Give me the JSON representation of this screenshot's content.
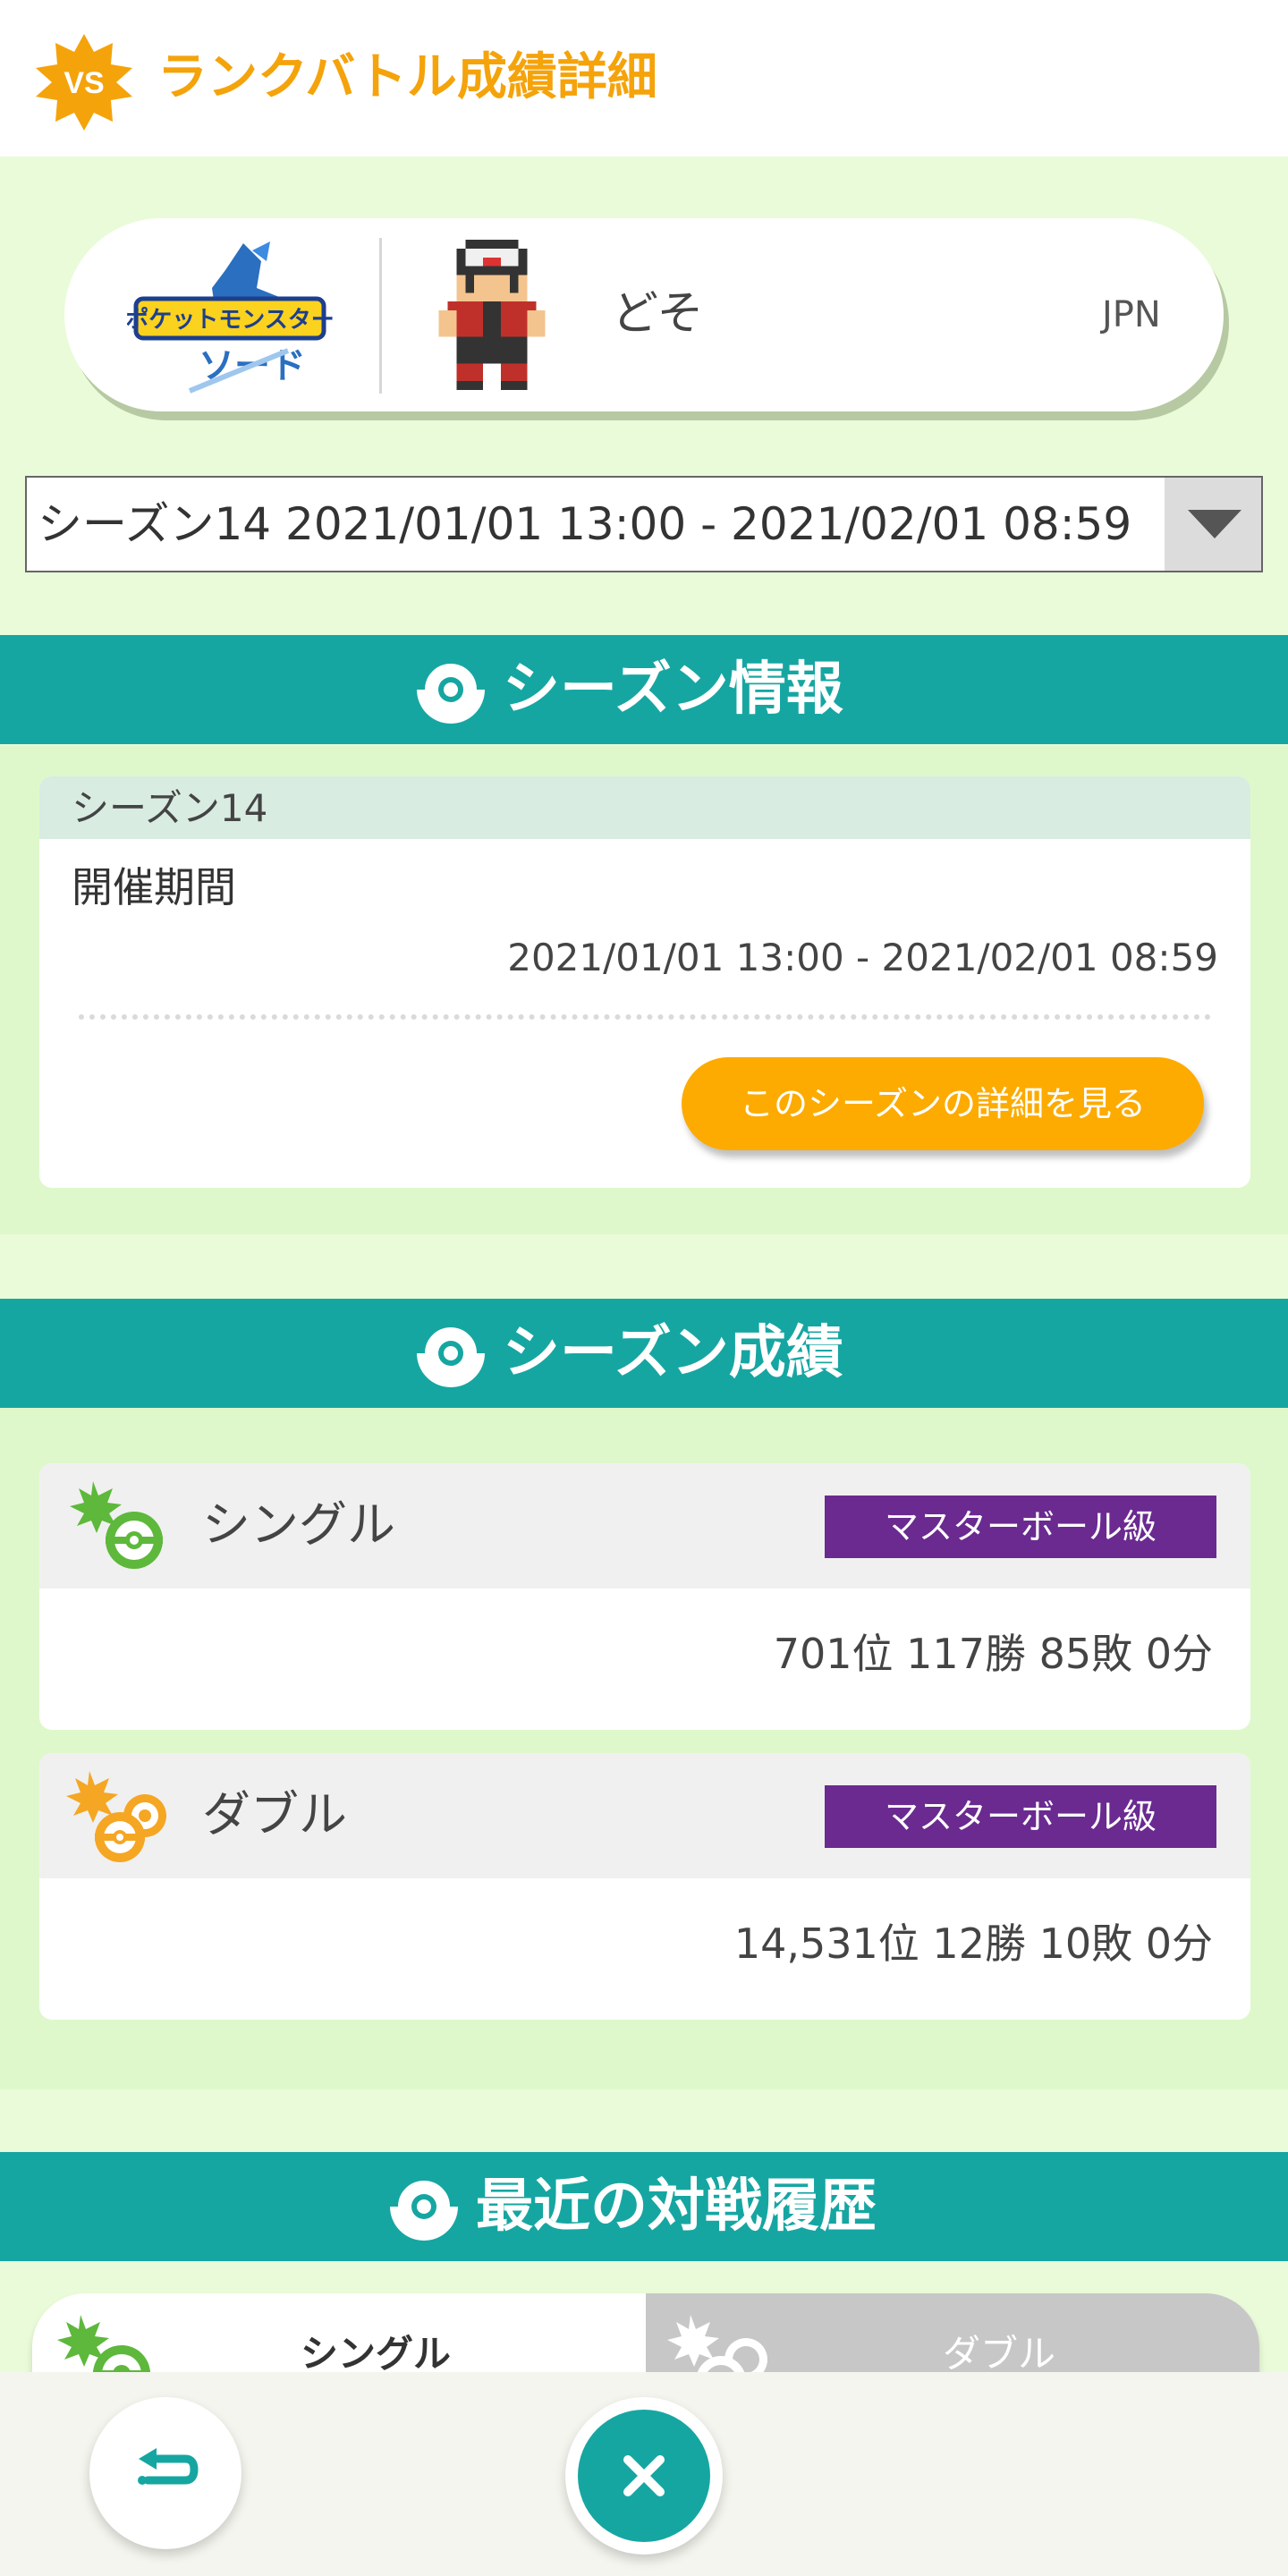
{
  "header": {
    "title": "ランクバトル成績詳細",
    "badge_text": "VS"
  },
  "profile": {
    "player_name": "どそ",
    "region": "JPN",
    "game_logo_top": "ポケットモンスター",
    "game_logo_bottom": "ソード"
  },
  "season_select": {
    "value": "シーズン14 2021/01/01 13:00 - 2021/02/01 08:59"
  },
  "season_info": {
    "section_title": "シーズン情報",
    "season_label": "シーズン14",
    "period_label": "開催期間",
    "period_value": "2021/01/01 13:00 - 2021/02/01 08:59",
    "detail_button": "このシーズンの詳細を見る"
  },
  "season_results": {
    "section_title": "シーズン成績",
    "single": {
      "name": "シングル",
      "rank_class": "マスターボール級",
      "stats": "701位 117勝 85敗 0分"
    },
    "double": {
      "name": "ダブル",
      "rank_class": "マスターボール級",
      "stats": "14,531位 12勝 10敗 0分"
    }
  },
  "recent": {
    "section_title": "最近の対戦履歴",
    "tabs": [
      {
        "label": "シングル",
        "active": true
      },
      {
        "label": "ダブル",
        "active": false
      }
    ]
  },
  "colors": {
    "accent_orange": "#f5a30b",
    "teal": "#16a6a2",
    "master_purple": "#6a2a90",
    "button_orange": "#fdab00",
    "single_green": "#5db83b",
    "double_orange": "#f5a623"
  }
}
